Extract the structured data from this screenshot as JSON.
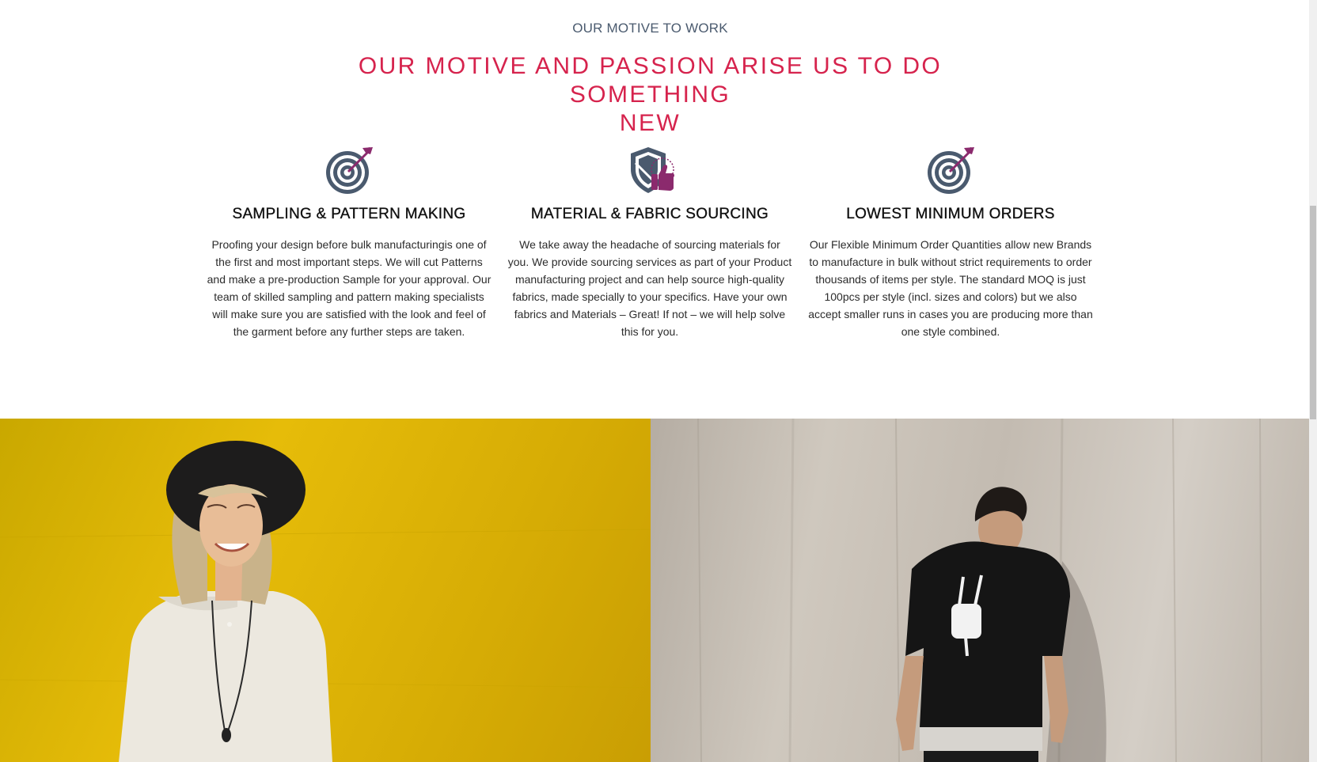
{
  "section": {
    "eyebrow": "OUR MOTIVE TO WORK",
    "headline_line1": "OUR MOTIVE AND PASSION ARISE US TO DO SOMETHING",
    "headline_line2": "NEW"
  },
  "features": [
    {
      "icon": "target-icon",
      "title": "SAMPLING & PATTERN MAKING",
      "text": "Proofing your design before bulk manufacturingis one of the first and most important steps. We will cut Patterns and make a pre-production Sample for your approval. Our team of skilled sampling and pattern making specialists will make sure you are satisfied with the look and feel of the garment before any further steps are taken."
    },
    {
      "icon": "shield-thumbs-up-icon",
      "title": "MATERIAL & FABRIC SOURCING",
      "text": "We take away the headache of sourcing materials for you. We provide sourcing services as part of your Product manufacturing project and can help source high-quality fabrics, made specially to your specifics. Have your own fabrics and Materials – Great! If not – we will help solve this for you."
    },
    {
      "icon": "target-icon",
      "title": "LOWEST MINIMUM ORDERS",
      "text": "Our Flexible Minimum Order Quantities allow new Brands to manufacture in bulk without strict requirements to order thousands of items per style. The standard MOQ is just 100pcs per style (incl. sizes and colors) but we also accept smaller runs in cases you are producing more than one style combined."
    }
  ],
  "colors": {
    "accent": "#d6234d",
    "eyebrow": "#4a5a6e",
    "icon_gray": "#4a5a6e",
    "icon_purple": "#8b2a6d",
    "yellow_bg": "#e2b808",
    "concrete_bg": "#c6beb4"
  }
}
